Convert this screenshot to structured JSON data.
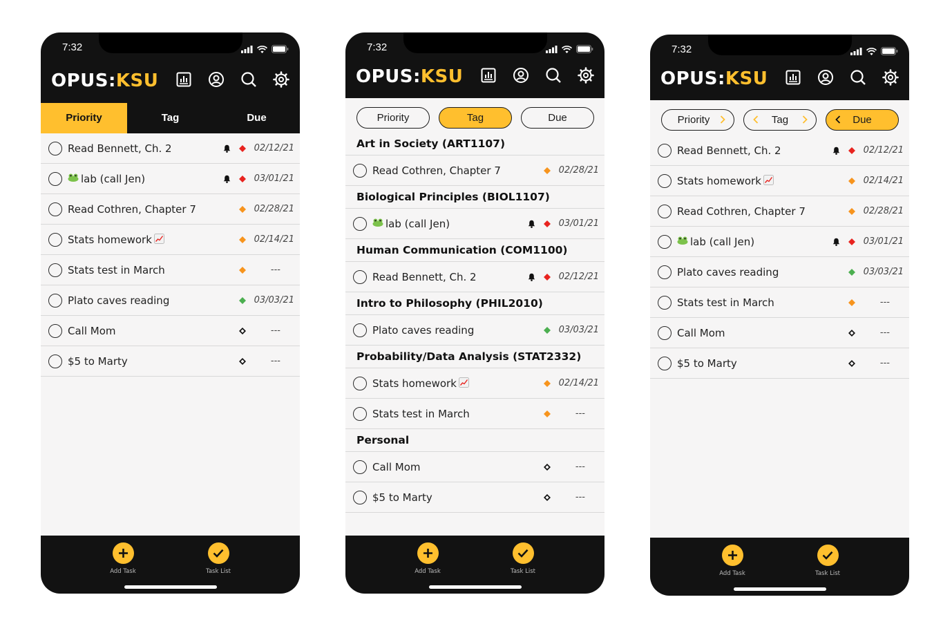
{
  "app": {
    "time": "7:32",
    "logo_prefix": "OPUS:",
    "logo_suffix": "KSU",
    "accent_color": "#ffbf2e",
    "icons": [
      "stats-icon",
      "profile-icon",
      "search-icon",
      "settings-icon"
    ]
  },
  "tabs": {
    "priority": "Priority",
    "tag": "Tag",
    "due": "Due",
    "active_screen1": "Priority",
    "active_screen2": "Tag",
    "active_screen3": "Due"
  },
  "bottom_nav": {
    "add_task": "Add Task",
    "task_list": "Task List"
  },
  "priority_colors": {
    "high": "#e8231f",
    "medium": "#f7941d",
    "low": "#4caf50",
    "none": "#111111"
  },
  "screen1": {
    "tasks": [
      {
        "title": "Read Bennett, Ch. 2",
        "due": "02/12/21",
        "priority": "high",
        "bell": true
      },
      {
        "title": "lab (call Jen)",
        "due": "03/01/21",
        "priority": "high",
        "bell": true,
        "emoji": "frog"
      },
      {
        "title": "Read Cothren, Chapter 7",
        "due": "02/28/21",
        "priority": "medium",
        "bell": false
      },
      {
        "title": "Stats homework",
        "due": "02/14/21",
        "priority": "medium",
        "bell": false,
        "emoji": "chart"
      },
      {
        "title": "Stats test in March",
        "due": "---",
        "priority": "medium",
        "bell": false
      },
      {
        "title": "Plato caves reading",
        "due": "03/03/21",
        "priority": "low",
        "bell": false
      },
      {
        "title": "Call Mom",
        "due": "---",
        "priority": "none",
        "bell": false
      },
      {
        "title": "$5 to Marty",
        "due": "---",
        "priority": "none",
        "bell": false
      }
    ]
  },
  "screen2": {
    "groups": [
      {
        "name": "Art in Society (ART1107)",
        "tasks": [
          {
            "title": "Read Cothren, Chapter 7",
            "due": "02/28/21",
            "priority": "medium",
            "bell": false
          }
        ]
      },
      {
        "name": "Biological Principles (BIOL1107)",
        "tasks": [
          {
            "title": "lab (call Jen)",
            "due": "03/01/21",
            "priority": "high",
            "bell": true,
            "emoji": "frog"
          }
        ]
      },
      {
        "name": "Human Communication (COM1100)",
        "tasks": [
          {
            "title": "Read Bennett, Ch. 2",
            "due": "02/12/21",
            "priority": "high",
            "bell": true
          }
        ]
      },
      {
        "name": "Intro to Philosophy (PHIL2010)",
        "tasks": [
          {
            "title": "Plato caves reading",
            "due": "03/03/21",
            "priority": "low",
            "bell": false
          }
        ]
      },
      {
        "name": "Probability/Data Analysis (STAT2332)",
        "tasks": [
          {
            "title": "Stats homework",
            "due": "02/14/21",
            "priority": "medium",
            "bell": false,
            "emoji": "chart"
          },
          {
            "title": "Stats test in March",
            "due": "---",
            "priority": "medium",
            "bell": false
          }
        ]
      },
      {
        "name": "Personal",
        "tasks": [
          {
            "title": "Call Mom",
            "due": "---",
            "priority": "none",
            "bell": false
          },
          {
            "title": "$5 to Marty",
            "due": "---",
            "priority": "none",
            "bell": false
          }
        ]
      }
    ]
  },
  "screen3": {
    "tasks": [
      {
        "title": "Read Bennett, Ch. 2",
        "due": "02/12/21",
        "priority": "high",
        "bell": true
      },
      {
        "title": "Stats homework",
        "due": "02/14/21",
        "priority": "medium",
        "bell": false,
        "emoji": "chart"
      },
      {
        "title": "Read Cothren, Chapter 7",
        "due": "02/28/21",
        "priority": "medium",
        "bell": false
      },
      {
        "title": "lab (call Jen)",
        "due": "03/01/21",
        "priority": "high",
        "bell": true,
        "emoji": "frog"
      },
      {
        "title": "Plato caves reading",
        "due": "03/03/21",
        "priority": "low",
        "bell": false
      },
      {
        "title": "Stats test in March",
        "due": "---",
        "priority": "medium",
        "bell": false
      },
      {
        "title": "Call Mom",
        "due": "---",
        "priority": "none",
        "bell": false
      },
      {
        "title": "$5 to Marty",
        "due": "---",
        "priority": "none",
        "bell": false
      }
    ]
  }
}
